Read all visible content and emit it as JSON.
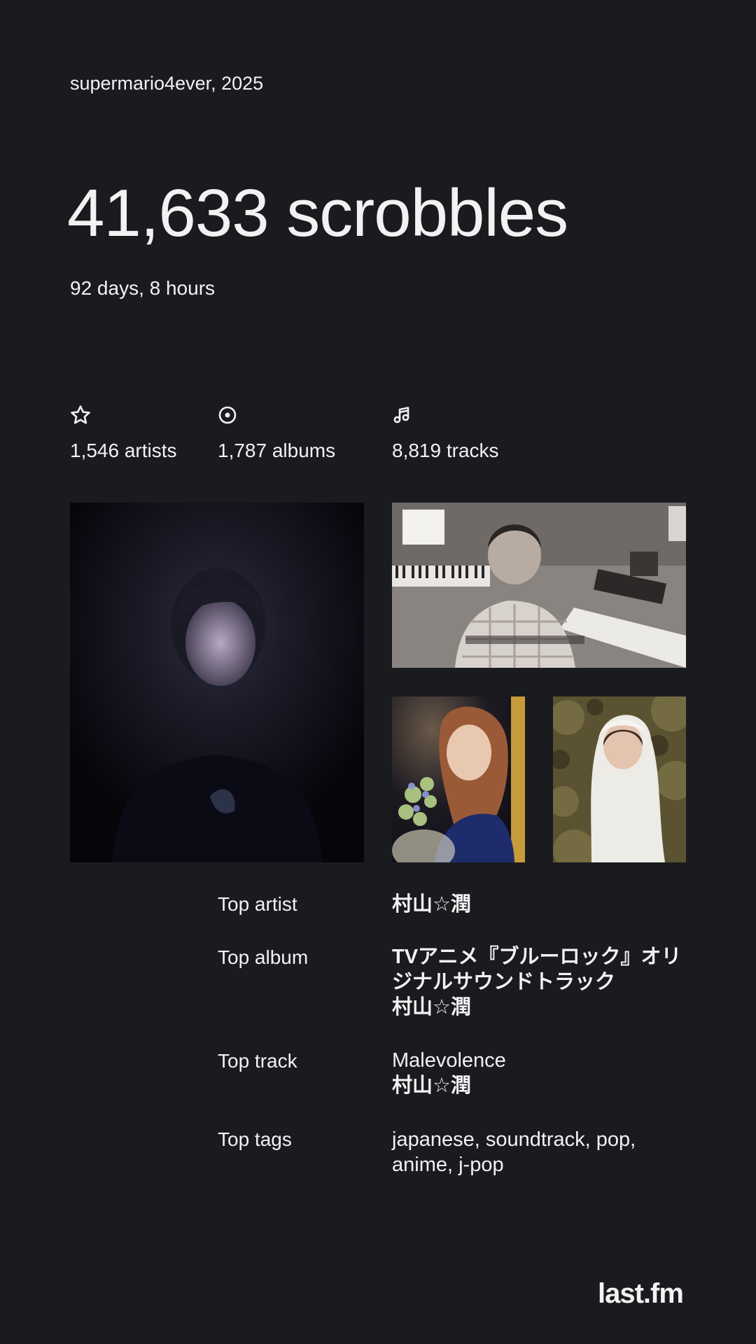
{
  "header": {
    "user_year": "supermario4ever, 2025"
  },
  "summary": {
    "scrobbles": "41,633 scrobbles",
    "listening_time": "92 days, 8 hours"
  },
  "stats": [
    {
      "icon": "star-icon",
      "label": "1,546 artists"
    },
    {
      "icon": "album-disc-icon",
      "label": "1,787 albums"
    },
    {
      "icon": "music-note-icon",
      "label": "8,819 tracks"
    }
  ],
  "top": {
    "artist": {
      "label": "Top artist",
      "value": "村山☆潤"
    },
    "album": {
      "label": "Top album",
      "title_line1": "TVアニメ『ブルーロック』オリ",
      "title_line2": "ジナルサウンドトラック",
      "artist": "村山☆潤"
    },
    "track": {
      "label": "Top track",
      "title": "Malevolence",
      "artist": "村山☆潤"
    },
    "tags": {
      "label": "Top tags",
      "line1": "japanese, soundtrack, pop,",
      "line2": "anime, j-pop"
    }
  },
  "footer": {
    "logo": "last.fm"
  },
  "colors": {
    "background": "#1a1b1f",
    "text": "#f2f2f2"
  }
}
